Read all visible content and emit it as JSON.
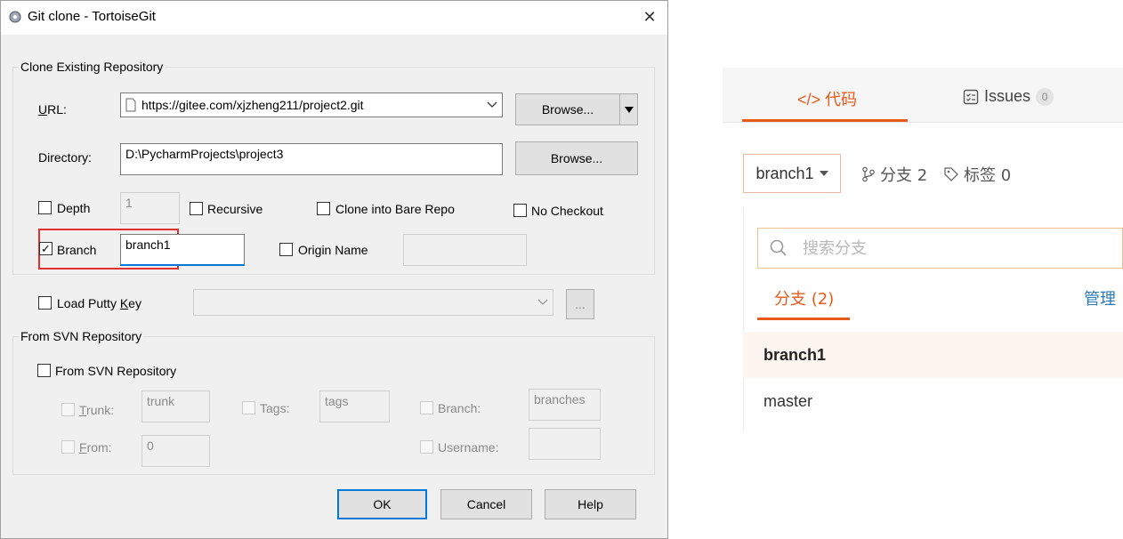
{
  "dialog": {
    "title": "Git clone - TortoiseGit",
    "close_glyph": "✕",
    "group_clone": "Clone Existing Repository",
    "url_label": "URL:",
    "url_value": "https://gitee.com/xjzheng211/project2.git",
    "browse_label": "Browse...",
    "directory_label": "Directory:",
    "directory_value": "D:\\PycharmProjects\\project3",
    "depth_label": "Depth",
    "depth_value": "1",
    "recursive_label": "Recursive",
    "bare_label": "Clone into Bare Repo",
    "nocheckout_label": "No Checkout",
    "branch_label": "Branch",
    "branch_value": "branch1",
    "origin_label": "Origin Name",
    "putty_label": "Load Putty Key",
    "ellipsis_label": "...",
    "group_svn": "From SVN Repository",
    "svn_label": "From SVN Repository",
    "trunk_label": "Trunk:",
    "trunk_value": "trunk",
    "tags_label": "Tags:",
    "tags_value": "tags",
    "svn_branch_label": "Branch:",
    "svn_branch_value": "branches",
    "from_label": "From:",
    "from_value": "0",
    "username_label": "Username:",
    "ok_label": "OK",
    "cancel_label": "Cancel",
    "help_label": "Help"
  },
  "gitee": {
    "tab_code": "代码",
    "tab_issues": "Issues",
    "issues_count": "0",
    "branch_selected": "branch1",
    "branch_count_label": "分支 2",
    "tag_count_label": "标签 0",
    "search_placeholder": "搜索分支",
    "subtab_label": "分支 (2)",
    "manage_label": "管理",
    "branches": [
      "branch1",
      "master"
    ]
  },
  "colors": {
    "accent_orange": "#e65a1c",
    "highlight_red": "#e03030",
    "link_blue": "#2a7ab8"
  }
}
